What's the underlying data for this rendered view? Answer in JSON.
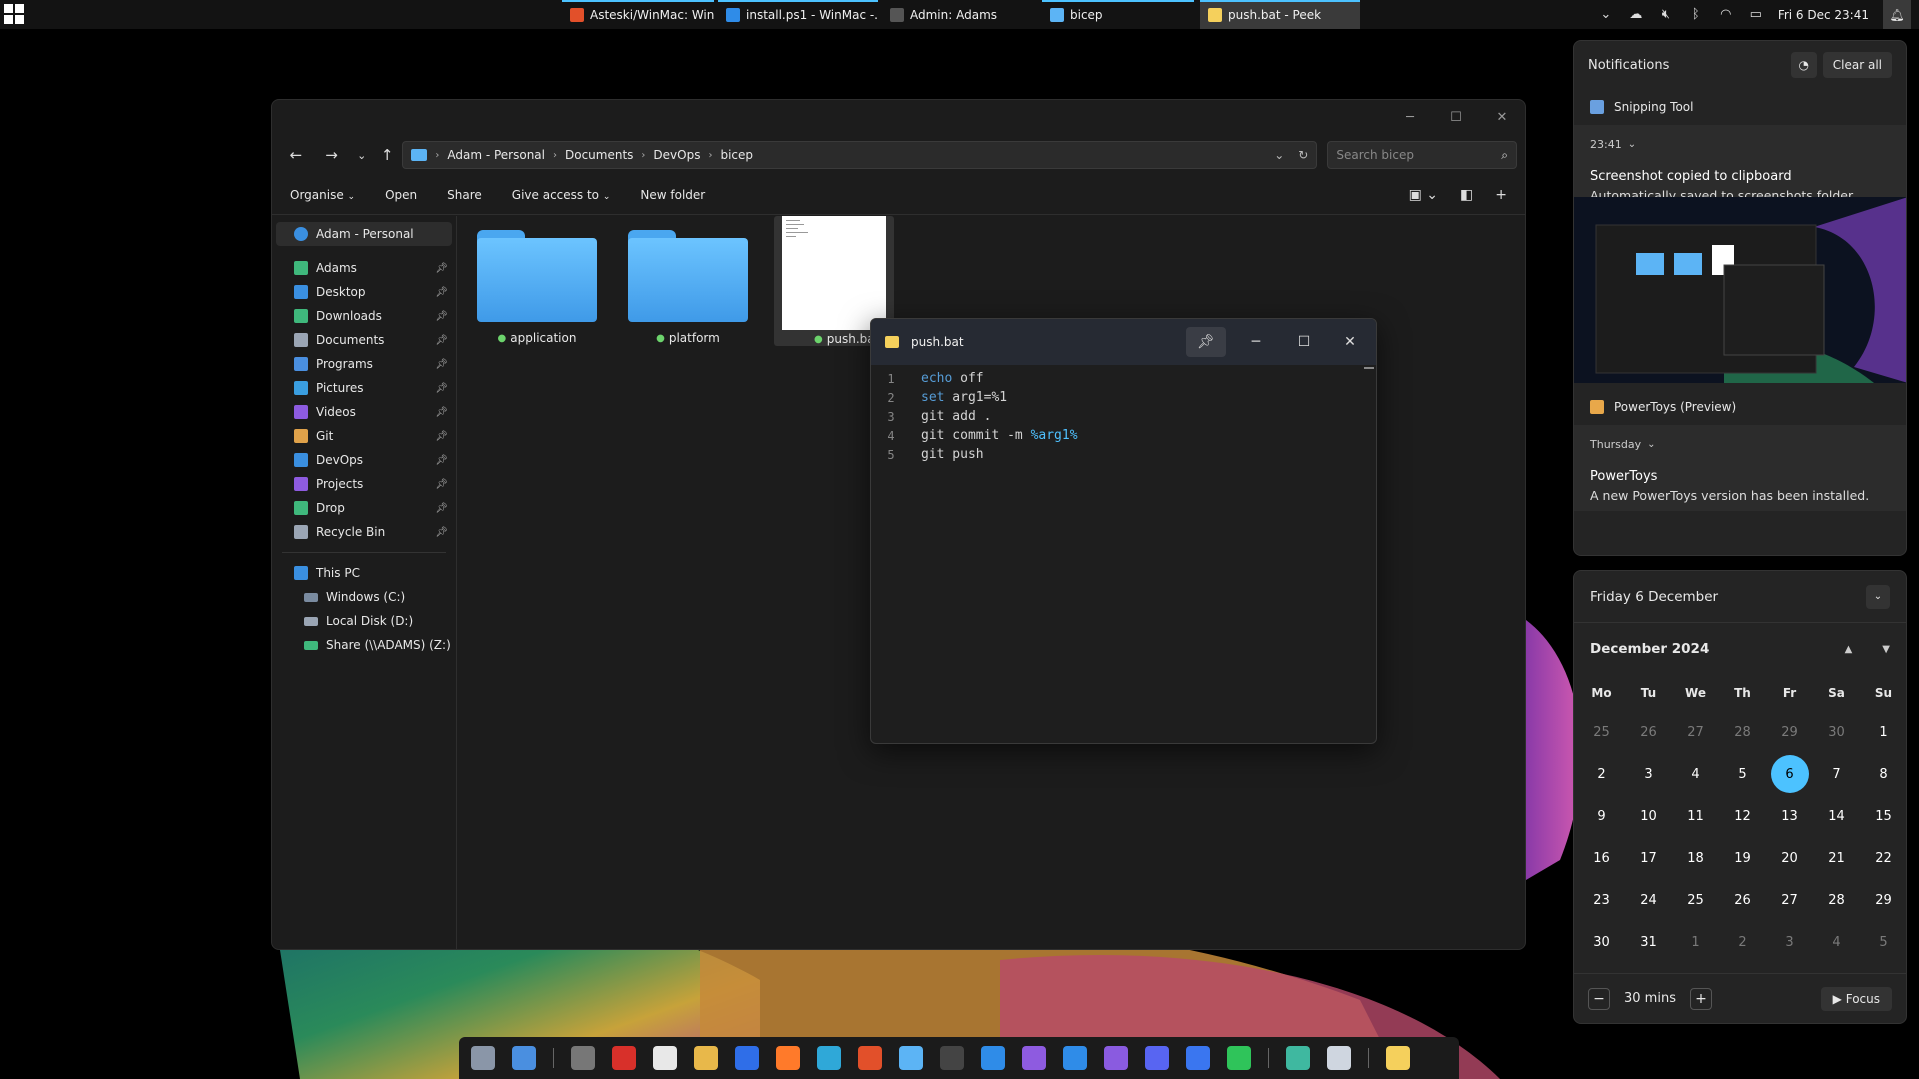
{
  "topbar": {
    "tasks": [
      {
        "label": "Asteski/WinMac: Win...",
        "icon": "brave-icon",
        "color": "#e2502a"
      },
      {
        "label": "install.ps1 - WinMac -...",
        "icon": "vscode-icon",
        "color": "#2f8ce8"
      },
      {
        "label": "Admin: Adams",
        "icon": "terminal-icon",
        "color": "#bbbbbb"
      },
      {
        "label": "bicep",
        "icon": "folder-icon",
        "color": "#5cb4f5"
      },
      {
        "label": "push.bat - Peek",
        "icon": "peek-icon",
        "color": "#f5d05c"
      }
    ],
    "clock": "Fri 6 Dec  23:41"
  },
  "explorer": {
    "breadcrumb": [
      "Adam - Personal",
      "Documents",
      "DevOps",
      "bicep"
    ],
    "search_placeholder": "Search bicep",
    "toolbar": {
      "organise": "Organise",
      "open": "Open",
      "share": "Share",
      "give_access": "Give access to",
      "new_folder": "New folder"
    },
    "sidebar": {
      "account": "Adam - Personal",
      "pinned": [
        {
          "label": "Adams",
          "icon": "user-folder-icon",
          "color": "#3fb87c"
        },
        {
          "label": "Desktop",
          "icon": "desktop-icon",
          "color": "#3a8fe0"
        },
        {
          "label": "Downloads",
          "icon": "downloads-icon",
          "color": "#3fb87c"
        },
        {
          "label": "Documents",
          "icon": "documents-icon",
          "color": "#9aa5b4"
        },
        {
          "label": "Programs",
          "icon": "programs-icon",
          "color": "#4a8fe0"
        },
        {
          "label": "Pictures",
          "icon": "pictures-icon",
          "color": "#3a9ee0"
        },
        {
          "label": "Videos",
          "icon": "videos-icon",
          "color": "#8d5be0"
        },
        {
          "label": "Git",
          "icon": "git-icon",
          "color": "#e0a24a"
        },
        {
          "label": "DevOps",
          "icon": "devops-icon",
          "color": "#3a8fe0"
        },
        {
          "label": "Projects",
          "icon": "visual-studio-icon",
          "color": "#8e5be0"
        },
        {
          "label": "Drop",
          "icon": "drop-icon",
          "color": "#3fb87c"
        },
        {
          "label": "Recycle Bin",
          "icon": "recycle-bin-icon",
          "color": "#9aa5b4"
        }
      ],
      "this_pc": "This PC",
      "drives": [
        {
          "label": "Windows (C:)",
          "icon": "drive-c-icon",
          "color": "#7a8ba0"
        },
        {
          "label": "Local Disk (D:)",
          "icon": "drive-d-icon",
          "color": "#9aa5b4"
        },
        {
          "label": "Share (\\\\ADAMS) (Z:)",
          "icon": "network-drive-icon",
          "color": "#3fb87c"
        }
      ]
    },
    "files": [
      {
        "name": "application",
        "type": "folder"
      },
      {
        "name": "platform",
        "type": "folder"
      },
      {
        "name": "push.ba",
        "type": "file"
      }
    ]
  },
  "peek": {
    "title": "push.bat",
    "lines": [
      {
        "n": "1",
        "parts": [
          {
            "t": "echo",
            "c": "kw"
          },
          {
            "t": " off",
            "c": ""
          }
        ]
      },
      {
        "n": "2",
        "parts": [
          {
            "t": "set",
            "c": "kw"
          },
          {
            "t": " arg1=%1",
            "c": ""
          }
        ]
      },
      {
        "n": "3",
        "parts": [
          {
            "t": "git add .",
            "c": ""
          }
        ]
      },
      {
        "n": "4",
        "parts": [
          {
            "t": "git commit -m ",
            "c": ""
          },
          {
            "t": "%arg1%",
            "c": "var"
          }
        ]
      },
      {
        "n": "5",
        "parts": [
          {
            "t": "git push",
            "c": ""
          }
        ]
      }
    ]
  },
  "notifications": {
    "title": "Notifications",
    "clear_all": "Clear all",
    "items": [
      {
        "app": "Snipping Tool",
        "time": "23:41",
        "heading": "Screenshot copied to clipboard",
        "body": "Automatically saved to screenshots folder."
      },
      {
        "app": "PowerToys (Preview)",
        "time": "Thursday",
        "heading": "PowerToys",
        "body": "A new PowerToys version has been installed."
      }
    ]
  },
  "calendar": {
    "date_heading": "Friday 6 December",
    "month": "December 2024",
    "dow": [
      "Mo",
      "Tu",
      "We",
      "Th",
      "Fr",
      "Sa",
      "Su"
    ],
    "days": [
      {
        "d": "25",
        "dim": true
      },
      {
        "d": "26",
        "dim": true
      },
      {
        "d": "27",
        "dim": true
      },
      {
        "d": "28",
        "dim": true
      },
      {
        "d": "29",
        "dim": true
      },
      {
        "d": "30",
        "dim": true
      },
      {
        "d": "1"
      },
      {
        "d": "2"
      },
      {
        "d": "3"
      },
      {
        "d": "4"
      },
      {
        "d": "5"
      },
      {
        "d": "6",
        "today": true
      },
      {
        "d": "7"
      },
      {
        "d": "8"
      },
      {
        "d": "9"
      },
      {
        "d": "10"
      },
      {
        "d": "11"
      },
      {
        "d": "12"
      },
      {
        "d": "13"
      },
      {
        "d": "14"
      },
      {
        "d": "15"
      },
      {
        "d": "16"
      },
      {
        "d": "17"
      },
      {
        "d": "18"
      },
      {
        "d": "19"
      },
      {
        "d": "20"
      },
      {
        "d": "21"
      },
      {
        "d": "22"
      },
      {
        "d": "23"
      },
      {
        "d": "24"
      },
      {
        "d": "25"
      },
      {
        "d": "26"
      },
      {
        "d": "27"
      },
      {
        "d": "28"
      },
      {
        "d": "29"
      },
      {
        "d": "30"
      },
      {
        "d": "31"
      },
      {
        "d": "1",
        "dim": true
      },
      {
        "d": "2",
        "dim": true
      },
      {
        "d": "3",
        "dim": true
      },
      {
        "d": "4",
        "dim": true
      },
      {
        "d": "5",
        "dim": true
      }
    ],
    "focus_duration": "30 mins",
    "focus_label": "Focus"
  },
  "taskbar": {
    "icons": [
      {
        "name": "settings-icon",
        "color": "#8a96a8",
        "sep_after": false
      },
      {
        "name": "photos-icon",
        "color": "#4a8fe0",
        "sep_after": true
      },
      {
        "name": "snipping-icon",
        "color": "#777777",
        "sep_after": false
      },
      {
        "name": "spider-icon",
        "color": "#d8302a",
        "sep_after": false
      },
      {
        "name": "notion-icon",
        "color": "#e8e8e8",
        "sep_after": false
      },
      {
        "name": "paint-icon",
        "color": "#e8b84a",
        "sep_after": false
      },
      {
        "name": "bitwarden-icon",
        "color": "#2f6ee8",
        "sep_after": false
      },
      {
        "name": "firefox-icon",
        "color": "#ff7a2a",
        "sep_after": false
      },
      {
        "name": "edge-icon",
        "color": "#2fa8d8",
        "sep_after": false
      },
      {
        "name": "brave-icon",
        "color": "#e2502a",
        "sep_after": false
      },
      {
        "name": "file-explorer-icon",
        "color": "#5cb4f5",
        "sep_after": false
      },
      {
        "name": "terminal-icon",
        "color": "#444444",
        "sep_after": false
      },
      {
        "name": "vscode-icon",
        "color": "#2f8ce8",
        "sep_after": false
      },
      {
        "name": "visual-studio-icon",
        "color": "#8e5be0",
        "sep_after": false
      },
      {
        "name": "remote-desktop-icon",
        "color": "#2f8ce8",
        "sep_after": false
      },
      {
        "name": "messenger-icon",
        "color": "#8a5be0",
        "sep_after": false
      },
      {
        "name": "discord-icon",
        "color": "#5865f2",
        "sep_after": false
      },
      {
        "name": "signal-icon",
        "color": "#3a76f0",
        "sep_after": false
      },
      {
        "name": "whatsapp-icon",
        "color": "#2fc45a",
        "sep_after": true
      },
      {
        "name": "downloads-folder-icon",
        "color": "#3fb8a0",
        "sep_after": false
      },
      {
        "name": "recycle-bin-icon",
        "color": "#cfd6e0",
        "sep_after": true
      },
      {
        "name": "peek-icon",
        "color": "#f5d05c",
        "sep_after": false
      }
    ]
  }
}
